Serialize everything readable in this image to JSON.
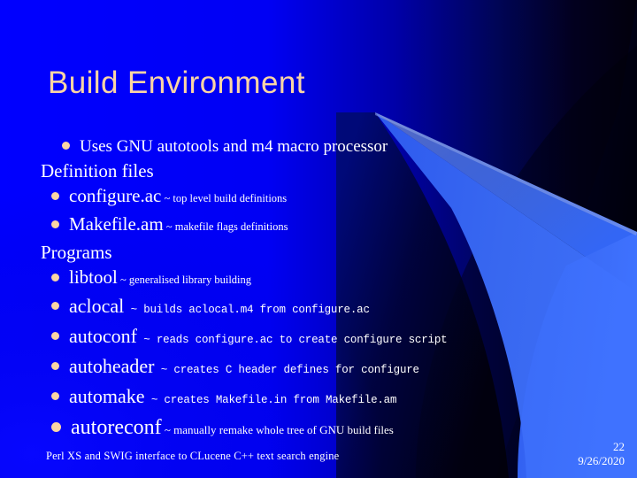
{
  "slide": {
    "title": "Build Environment",
    "footer": "Perl XS and SWIG interface to CLucene C++ text search engine",
    "slide_number": "22",
    "date": "9/26/2020"
  },
  "colors": {
    "background_blue": "#0000ff",
    "background_dark": "#02000f",
    "accent_blue": "#3366f5",
    "title_color": "#fbd5a5",
    "bullet_color": "#fbd5a5",
    "text_color": "#ffffff"
  },
  "body": {
    "lines": [
      {
        "bullet": true,
        "text": "Uses GNU autotools and m4 macro processor",
        "desc": "",
        "level": "lvl-a",
        "mono": false
      },
      {
        "bullet": false,
        "text": "Definition files",
        "desc": "",
        "level": "lvl-head",
        "mono": false
      },
      {
        "bullet": true,
        "text": "configure.ac",
        "desc": " ~ top level build definitions",
        "level": "lvl-b",
        "mono": false
      },
      {
        "bullet": true,
        "text": "Makefile.am",
        "desc": " ~ makefile flags definitions",
        "level": "lvl-b",
        "mono": false
      },
      {
        "bullet": false,
        "text": "Programs",
        "desc": "",
        "level": "lvl-head",
        "mono": false
      },
      {
        "bullet": true,
        "text": "libtool",
        "desc": " ~ generalised library building",
        "level": "lvl-b",
        "mono": false
      },
      {
        "bullet": true,
        "text": "aclocal",
        "desc": " ~ builds aclocal.m4 from configure.ac",
        "level": "lvl-c",
        "mono": true
      },
      {
        "bullet": true,
        "text": "autoconf",
        "desc": " ~ reads configure.ac to create configure script",
        "level": "lvl-c",
        "mono": true
      },
      {
        "bullet": true,
        "text": "autoheader",
        "desc": " ~ creates C header defines for configure",
        "level": "lvl-c",
        "mono": true
      },
      {
        "bullet": true,
        "text": "automake",
        "desc": " ~ creates Makefile.in from Makefile.am",
        "level": "lvl-c",
        "mono": true
      },
      {
        "bullet": true,
        "text": "autoreconf",
        "desc": " ~ manually remake whole tree of GNU build files",
        "level": "lvl-d",
        "mono": false
      }
    ]
  }
}
